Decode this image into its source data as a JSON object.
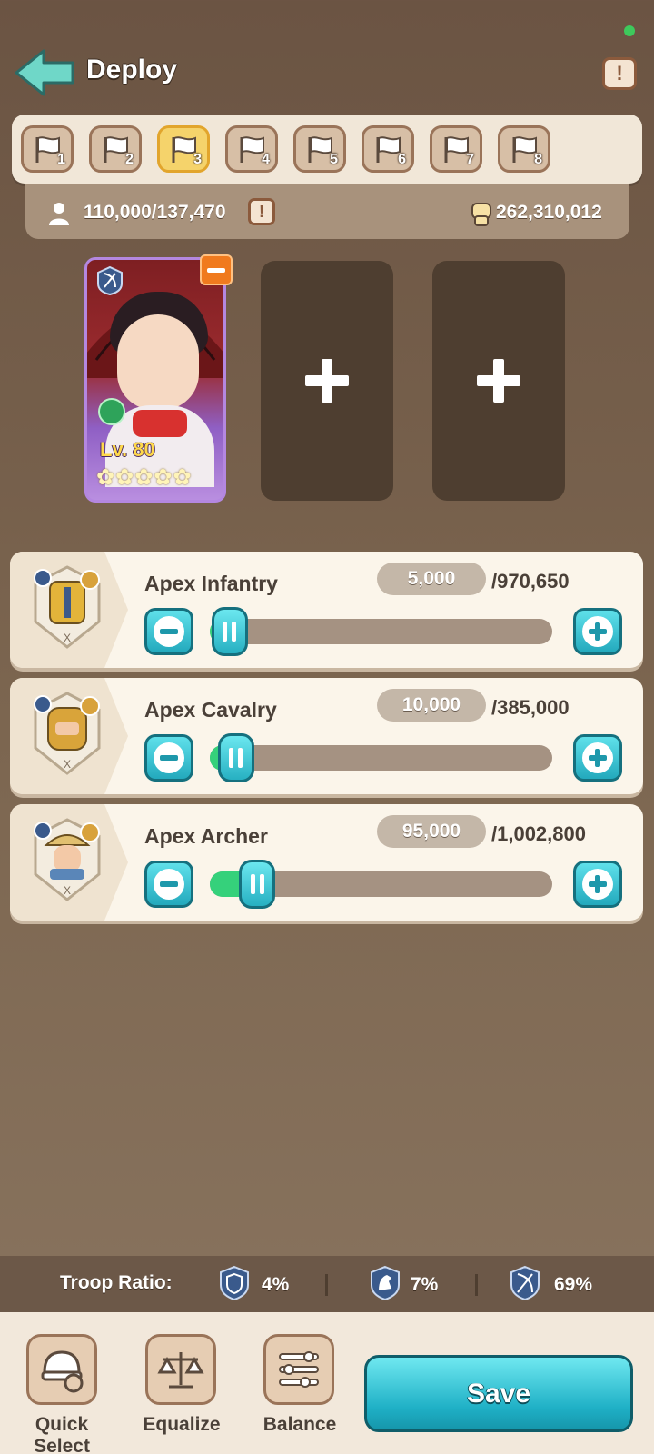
{
  "header": {
    "title": "Deploy",
    "info_icon": "exclamation-icon",
    "back_icon": "back-arrow-icon"
  },
  "flags": [
    {
      "num": "1",
      "active": false
    },
    {
      "num": "2",
      "active": false
    },
    {
      "num": "3",
      "active": true
    },
    {
      "num": "4",
      "active": false
    },
    {
      "num": "5",
      "active": false
    },
    {
      "num": "6",
      "active": false
    },
    {
      "num": "7",
      "active": false
    },
    {
      "num": "8",
      "active": false
    }
  ],
  "capacity": {
    "text": "110,000/137,470",
    "warn": "!",
    "power": "262,310,012"
  },
  "hero": {
    "level": "Lv. 80",
    "stars": 5
  },
  "troops": [
    {
      "name": "Apex Infantry",
      "count": "5,000",
      "max": "/970,650",
      "fraction": 0.005,
      "class": "shield-icon"
    },
    {
      "name": "Apex Cavalry",
      "count": "10,000",
      "max": "/385,000",
      "fraction": 0.026,
      "class": "horse-icon"
    },
    {
      "name": "Apex Archer",
      "count": "95,000",
      "max": "/1,002,800",
      "fraction": 0.095,
      "class": "bow-icon"
    }
  ],
  "ratio": {
    "label": "Troop Ratio:",
    "infantry": "4%",
    "cavalry": "7%",
    "archer": "69%"
  },
  "footer": {
    "quick_select": "Quick Select",
    "equalize": "Equalize",
    "balance": "Balance",
    "save": "Save"
  },
  "colors": {
    "accent": "#23a9bd",
    "fill": "#35d17b",
    "flag_active": "#f5d36b"
  }
}
